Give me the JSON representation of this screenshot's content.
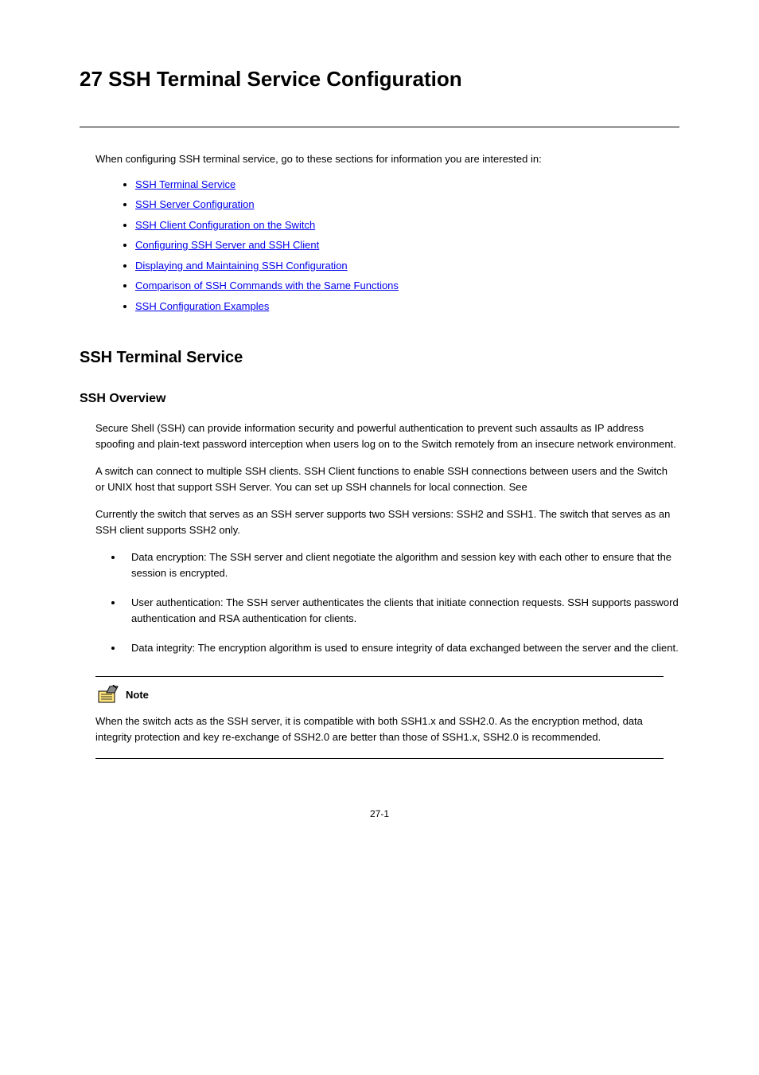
{
  "chapter": {
    "number": "27",
    "title": "SSH Terminal Service Configuration"
  },
  "intro": "When configuring SSH terminal service, go to these sections for information you are interested in:",
  "toc": [
    {
      "label": "SSH Terminal Service"
    },
    {
      "label": "SSH Server Configuration"
    },
    {
      "label": "SSH Client Configuration on the Switch"
    },
    {
      "label": "Configuring SSH Server and SSH Client"
    },
    {
      "label": "Displaying and Maintaining SSH Configuration"
    },
    {
      "label": "Comparison of SSH Commands with the Same Functions"
    },
    {
      "label": "SSH Configuration Examples"
    }
  ],
  "section": {
    "title": "SSH Terminal Service"
  },
  "subsection": {
    "title": "SSH Overview"
  },
  "paragraphs": {
    "p1": "Secure Shell (SSH) can provide information security and powerful authentication to prevent such assaults as IP address spoofing and plain-text password interception when users log on to the Switch remotely from an insecure network environment.",
    "p2": "A switch can connect to multiple SSH clients. SSH Client functions to enable SSH connections between users and the Switch or UNIX host that support SSH Server. You can set up SSH channels for local connection. See"
  },
  "features_intro": "Currently the switch that serves as an SSH server supports two SSH versions: SSH2 and SSH1. The switch that serves as an SSH client supports SSH2 only.",
  "features": [
    "Data encryption: The SSH server and client negotiate the algorithm and session key with each other to ensure that the session is encrypted.",
    "User authentication: The SSH server authenticates the clients that initiate connection requests. SSH supports password authentication and RSA authentication for clients.",
    "Data integrity: The encryption algorithm is used to ensure integrity of data exchanged between the server and the client."
  ],
  "note": {
    "label": "Note",
    "text": "When the switch acts as the SSH server, it is compatible with both SSH1.x and SSH2.0. As the encryption method, data integrity protection and key re-exchange of SSH2.0 are better than those of SSH1.x, SSH2.0 is recommended."
  },
  "page_number": "27-1"
}
